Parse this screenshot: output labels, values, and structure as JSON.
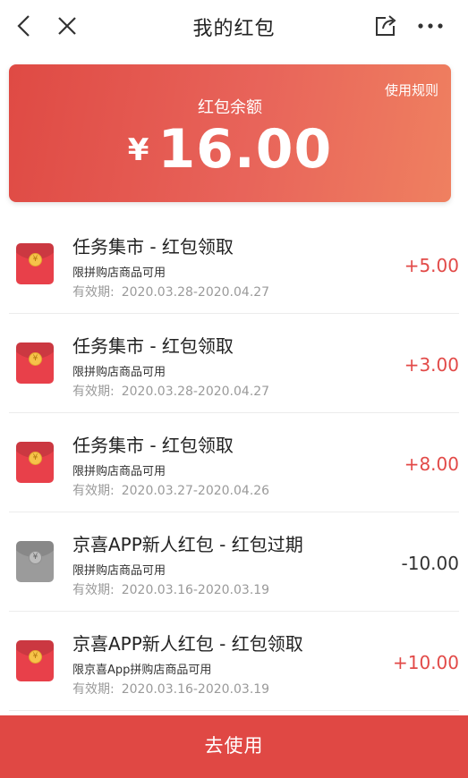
{
  "header": {
    "title": "我的红包"
  },
  "balance": {
    "rules_label": "使用规则",
    "label": "红包余额",
    "currency": "¥",
    "amount": "16.00"
  },
  "items": [
    {
      "name": "任务集市 - 红包领取",
      "limit": "限拼购店商品可用",
      "validity_label": "有效期:",
      "validity": "2020.03.28-2020.04.27",
      "amount": "+5.00",
      "status": "active"
    },
    {
      "name": "任务集市 - 红包领取",
      "limit": "限拼购店商品可用",
      "validity_label": "有效期:",
      "validity": "2020.03.28-2020.04.27",
      "amount": "+3.00",
      "status": "active"
    },
    {
      "name": "任务集市 - 红包领取",
      "limit": "限拼购店商品可用",
      "validity_label": "有效期:",
      "validity": "2020.03.27-2020.04.26",
      "amount": "+8.00",
      "status": "active"
    },
    {
      "name": "京喜APP新人红包 - 红包过期",
      "limit": "限拼购店商品可用",
      "validity_label": "有效期:",
      "validity": "2020.03.16-2020.03.19",
      "amount": "-10.00",
      "status": "expired"
    },
    {
      "name": "京喜APP新人红包 - 红包领取",
      "limit": "限京喜App拼购店商品可用",
      "validity_label": "有效期:",
      "validity": "2020.03.16-2020.03.19",
      "amount": "+10.00",
      "status": "active"
    }
  ],
  "footer": {
    "use_label": "去使用"
  },
  "colors": {
    "accent": "#e04844",
    "positive_amount": "#e24a48",
    "expired_envelope": "#9b9b9b"
  }
}
